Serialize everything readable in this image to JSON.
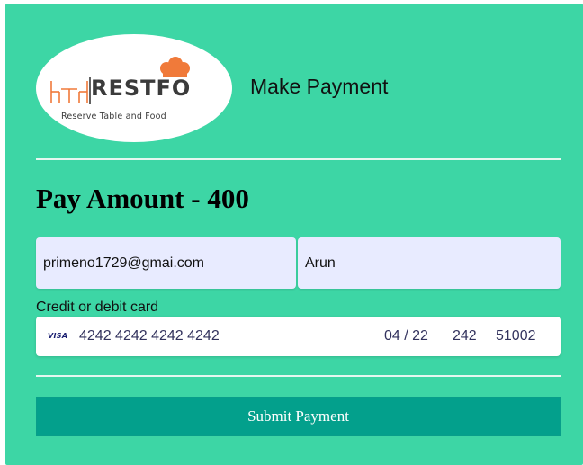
{
  "logo": {
    "name": "RESTFO",
    "tagline": "Reserve Table and Food"
  },
  "header": {
    "title": "Make Payment"
  },
  "payment": {
    "amount_heading": "Pay Amount - 400"
  },
  "form": {
    "email_value": "primeno1729@gmai.com",
    "name_value": "Arun",
    "card_label": "Credit or debit card",
    "card": {
      "brand": "VISA",
      "number": "4242 4242 4242 4242",
      "expiry": "04 / 22",
      "cvc": "242",
      "zip": "51002"
    },
    "submit_label": "Submit Payment"
  },
  "colors": {
    "background": "#3dd6a5",
    "input_background": "#e8ebff",
    "submit_button": "#03a08c"
  }
}
